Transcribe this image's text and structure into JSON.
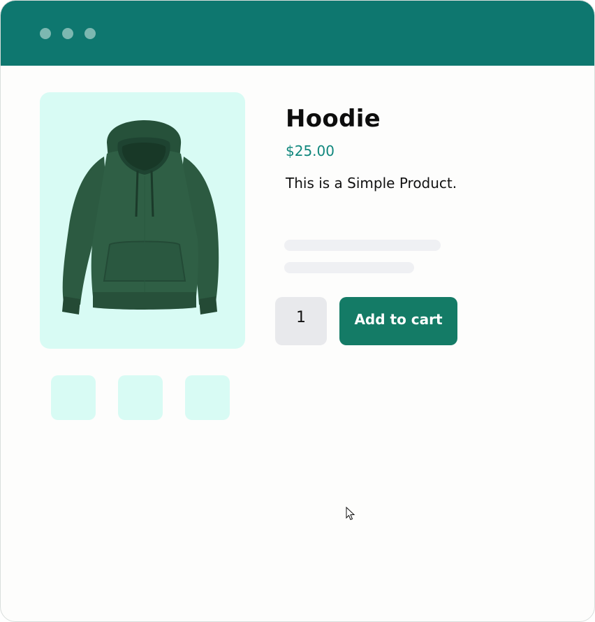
{
  "window": {
    "controls": [
      "dot",
      "dot",
      "dot"
    ]
  },
  "product": {
    "title": "Hoodie",
    "price": "$25.00",
    "description": "This is a Simple Product.",
    "image_icon": "hoodie-image"
  },
  "purchase": {
    "quantity": "1",
    "add_to_cart_label": "Add to cart"
  },
  "gallery": {
    "thumbnail_count": 3
  },
  "colors": {
    "titlebar": "#0e776f",
    "accent": "#10877d",
    "button": "#147b66",
    "gallery_bg": "#d8fbf4",
    "hoodie": "#2c5a41"
  }
}
